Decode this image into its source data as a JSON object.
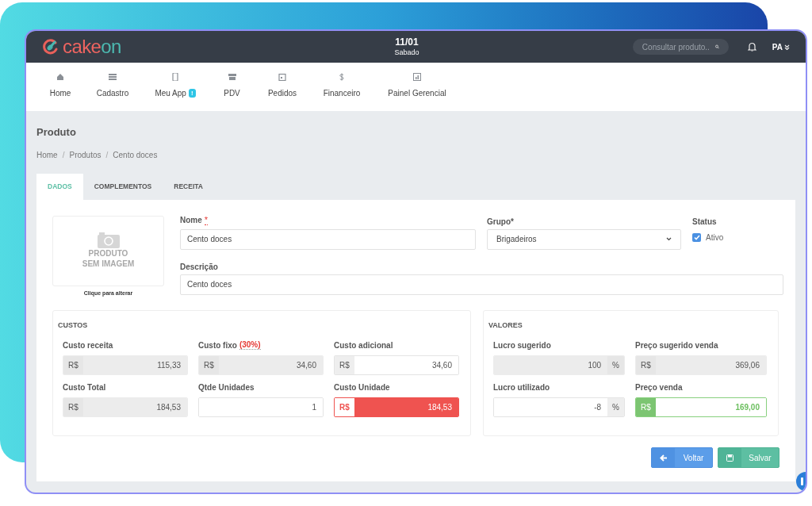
{
  "header": {
    "logo_first": "cake",
    "logo_second": "on",
    "date": "11/01",
    "weekday": "Sabado",
    "search_placeholder": "Consultar produto..",
    "user": "PA"
  },
  "nav": [
    {
      "label": "Home"
    },
    {
      "label": "Cadastro"
    },
    {
      "label": "Meu App",
      "badge": "!"
    },
    {
      "label": "PDV"
    },
    {
      "label": "Pedidos"
    },
    {
      "label": "Financeiro"
    },
    {
      "label": "Painel Gerencial"
    }
  ],
  "page": {
    "title": "Produto",
    "breadcrumb_separator": "/",
    "breadcrumb": [
      "Home",
      "Produtos",
      "Cento doces"
    ]
  },
  "tabs": [
    {
      "label": "DADOS",
      "selected": true
    },
    {
      "label": "COMPLEMENTOS",
      "selected": false
    },
    {
      "label": "RECEITA",
      "selected": false
    }
  ],
  "image": {
    "line_1": "PRODUTO",
    "line_2": "SEM IMAGEM",
    "caption": "Clique para alterar"
  },
  "form": {
    "nome": {
      "label": "Nome",
      "required_mark": "*",
      "value": "Cento doces"
    },
    "grupo": {
      "label": "Grupo*",
      "value": "Brigadeiros"
    },
    "status": {
      "label": "Status",
      "option": "Ativo",
      "checked": true
    },
    "descricao": {
      "label": "Descrição",
      "value": "Cento doces"
    }
  },
  "custos": {
    "title": "CUSTOS",
    "fields": [
      {
        "label": "Custo receita",
        "prefix": "R$",
        "value": "115,33",
        "kind": "readonly"
      },
      {
        "label": "Custo fixo",
        "note": "(30%)",
        "prefix": "R$",
        "value": "34,60",
        "kind": "readonly"
      },
      {
        "label": "Custo adicional",
        "prefix": "R$",
        "value": "34,60",
        "kind": "editable"
      },
      {
        "label": "Custo Total",
        "prefix": "R$",
        "value": "184,53",
        "kind": "readonly"
      },
      {
        "label": "Qtde Unidades",
        "value": "1",
        "kind": "editable"
      },
      {
        "label": "Custo Unidade",
        "prefix": "R$",
        "value": "184,53",
        "kind": "danger"
      }
    ]
  },
  "valores": {
    "title": "VALORES",
    "fields": [
      {
        "label": "Lucro sugerido",
        "suffix": "%",
        "value": "100",
        "kind": "readonly"
      },
      {
        "label": "Preço sugerido venda",
        "prefix": "R$",
        "value": "369,06",
        "kind": "readonly"
      },
      {
        "label": "Lucro utilizado",
        "suffix": "%",
        "value": "-8",
        "kind": "editable"
      },
      {
        "label": "Preço venda",
        "prefix": "R$",
        "value": "169,00",
        "kind": "success"
      }
    ]
  },
  "buttons": [
    {
      "label": "Voltar",
      "kind": "back"
    },
    {
      "label": "Salvar",
      "kind": "save"
    }
  ]
}
